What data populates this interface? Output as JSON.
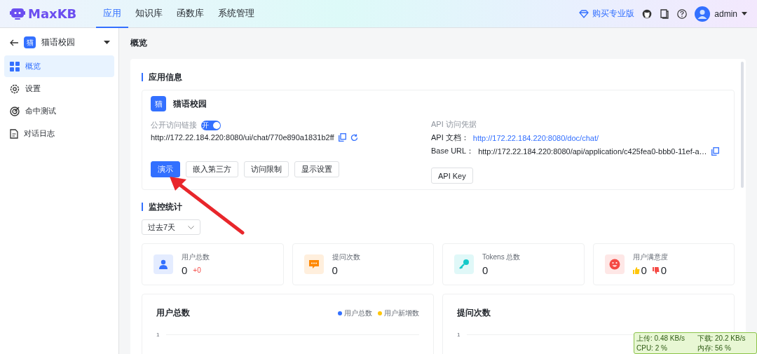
{
  "header": {
    "logo_text": "MaxKB",
    "nav": [
      {
        "label": "应用",
        "selected": true
      },
      {
        "label": "知识库",
        "selected": false
      },
      {
        "label": "函数库",
        "selected": false
      },
      {
        "label": "系统管理",
        "selected": false
      }
    ],
    "upgrade": "购买专业版",
    "user": "admin"
  },
  "sidebar": {
    "app_avatar": "猫",
    "app_name": "猫语校园",
    "items": [
      {
        "label": "概览",
        "selected": true
      },
      {
        "label": "设置",
        "selected": false
      },
      {
        "label": "命中测试",
        "selected": false
      },
      {
        "label": "对话日志",
        "selected": false
      }
    ]
  },
  "page_title": "概览",
  "app_info": {
    "heading": "应用信息",
    "avatar": "猫",
    "name": "猫语校园",
    "public_link_label": "公开访问链接",
    "toggle": {
      "label": "开",
      "on": true
    },
    "url": "http://172.22.184.220:8080/ui/chat/770e890a1831b2ff",
    "api_label": "API 访问凭据",
    "api_doc_label": "API 文档：",
    "api_doc_url": "http://172.22.184.220:8080/doc/chat/",
    "base_url_label": "Base URL：",
    "base_url": "http://172.22.184.220:8080/api/application/c425fea0-bbb0-11ef-a…",
    "buttons": [
      {
        "label": "演示",
        "primary": true
      },
      {
        "label": "嵌入第三方",
        "primary": false
      },
      {
        "label": "访问限制",
        "primary": false
      },
      {
        "label": "显示设置",
        "primary": false
      }
    ],
    "api_key_button": "API Key"
  },
  "monitor": {
    "heading": "监控统计",
    "range": "过去7天",
    "stats": [
      {
        "kind": "users",
        "label": "用户总数",
        "value": "0",
        "delta": "+0",
        "color": "#3370ff"
      },
      {
        "kind": "questions",
        "label": "提问次数",
        "value": "0",
        "color": "#ff8800"
      },
      {
        "kind": "tokens",
        "label": "Tokens 总数",
        "value": "0",
        "color": "#14c9c9"
      },
      {
        "kind": "satisfaction",
        "label": "用户满意度",
        "likes": "0",
        "dislikes": "0",
        "color": "#f54a45"
      }
    ],
    "charts": [
      {
        "title": "用户总数",
        "legend": [
          {
            "label": "用户总数",
            "color": "#3370ff"
          },
          {
            "label": "用户新增数",
            "color": "#ffc60a"
          }
        ],
        "y_tick": "1"
      },
      {
        "title": "提问次数",
        "y_tick": "1"
      }
    ]
  },
  "net_widget": {
    "upload": "上传: 0.48 KB/s",
    "download": "下载: 20.2 KB/s",
    "cpu": "CPU: 2 %",
    "memory": "内存: 56 %"
  }
}
